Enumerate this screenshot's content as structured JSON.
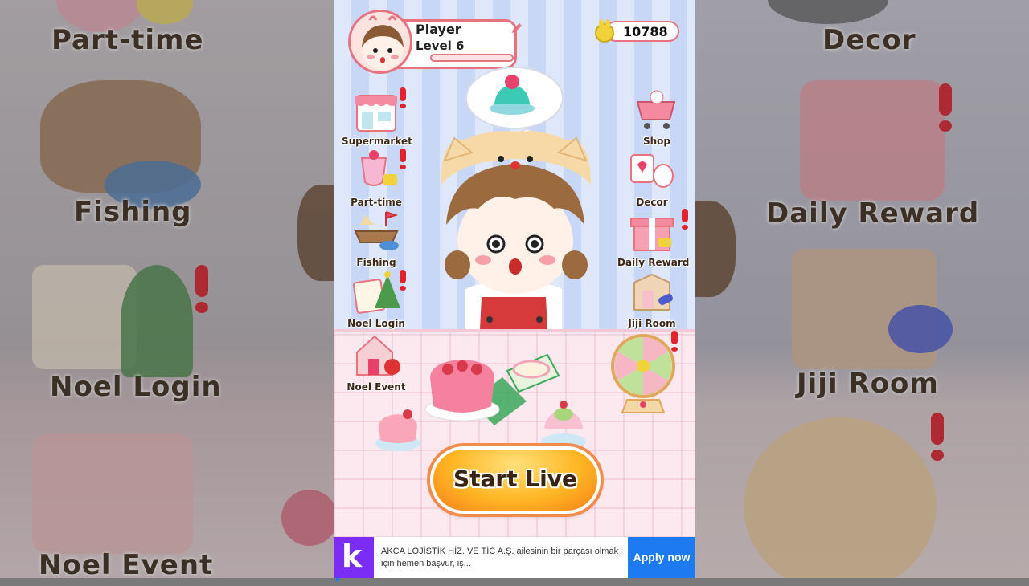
{
  "colors": {
    "accent": "#e8737f",
    "start_button": "#ffb624",
    "ad_button": "#1e7af0",
    "ad_logo": "#7b2cf5"
  },
  "background_left": {
    "labels": [
      "Part-time",
      "Fishing",
      "Noel Login",
      "Noel Event"
    ]
  },
  "background_right": {
    "labels": [
      "Decor",
      "Daily Reward",
      "Jiji Room"
    ]
  },
  "profile": {
    "name": "Player",
    "level": "Level 6",
    "xp_fraction": 0.0,
    "edit_icon": "pencil-icon"
  },
  "currency": {
    "amount": "10788",
    "icon": "gold-bunny-coin-icon"
  },
  "menu_left": [
    {
      "label": "Supermarket",
      "icon": "supermarket-icon",
      "alert": true
    },
    {
      "label": "Part-time",
      "icon": "part-time-drink-icon",
      "alert": true
    },
    {
      "label": "Fishing",
      "icon": "fishing-boat-icon",
      "alert": false
    },
    {
      "label": "Noel Login",
      "icon": "xmas-calendar-icon",
      "alert": true
    },
    {
      "label": "Noel Event",
      "icon": "gingerbread-house-icon",
      "alert": false
    }
  ],
  "menu_right": [
    {
      "label": "Shop",
      "icon": "shopping-cart-icon",
      "alert": false
    },
    {
      "label": "Decor",
      "icon": "decor-hairdryer-icon",
      "alert": false
    },
    {
      "label": "Daily Reward",
      "icon": "gift-box-icon",
      "alert": true
    },
    {
      "label": "Jiji Room",
      "icon": "room-icon",
      "alert": false
    },
    {
      "label": "",
      "icon": "prize-wheel-icon",
      "alert": true
    }
  ],
  "start_button": {
    "label": "Start Live"
  },
  "ad": {
    "logo_letter": "k",
    "text": "AKCA LOJİSTİK HİZ. VE TİC A.Ş. ailesinin bir parçası olmak için hemen başvur, iş...",
    "cta": "Apply now"
  }
}
